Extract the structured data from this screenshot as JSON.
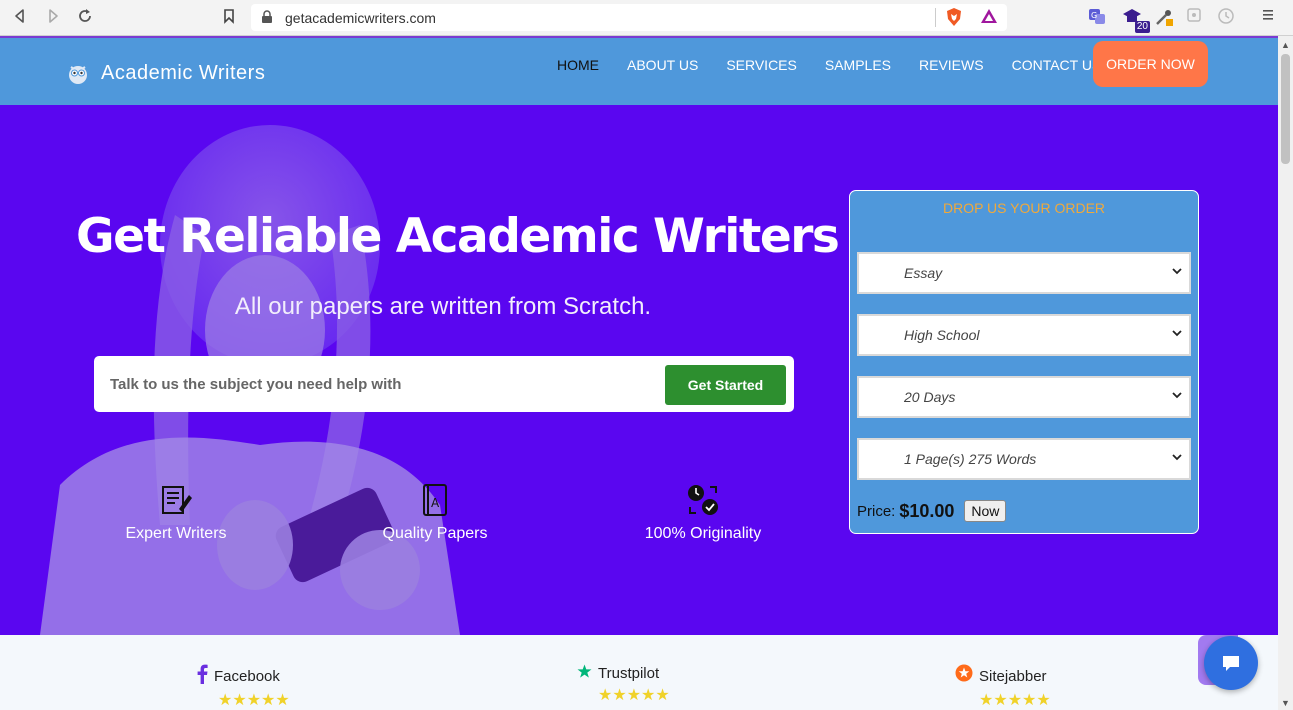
{
  "browser": {
    "url": "getacademicwriters.com",
    "extension_badge": "20"
  },
  "header": {
    "brand": "Academic Writers",
    "nav": [
      "HOME",
      "ABOUT US",
      "SERVICES",
      "SAMPLES",
      "REVIEWS",
      "CONTACT US"
    ],
    "active_nav": "HOME",
    "order_button": "ORDER NOW"
  },
  "hero": {
    "title": "Get Reliable Academic Writers Help .",
    "subtitle": "All our papers are written from Scratch.",
    "search_placeholder": "Talk to us the subject you need help with",
    "cta": "Get Started",
    "features": [
      {
        "label": "Expert Writers",
        "icon": "writing-icon"
      },
      {
        "label": "Quality Papers",
        "icon": "book-icon"
      },
      {
        "label": "100% Originality",
        "icon": "originality-icon"
      }
    ]
  },
  "order_form": {
    "title": "DROP US YOUR ORDER",
    "paper_type": "Essay",
    "level": "High School",
    "deadline": "20 Days",
    "pages": "1 Page(s) 275 Words",
    "price_label": "Price:",
    "price_value": "$10.00",
    "now_button": "Now"
  },
  "reviews": [
    {
      "name": "Facebook",
      "stars": "★★★★★",
      "icon": "facebook-icon"
    },
    {
      "name": "Trustpilot",
      "stars": "★★★★★",
      "icon": "trustpilot-icon"
    },
    {
      "name": "Sitejabber",
      "stars": "★★★★★",
      "icon": "sitejabber-icon"
    }
  ],
  "colors": {
    "header_bg": "#4f98db",
    "hero_bg": "#5a06f0",
    "order_button": "#ff7648",
    "cta_button": "#2d8f2f",
    "order_title": "#f0a93b",
    "stars": "#f0d22a"
  }
}
